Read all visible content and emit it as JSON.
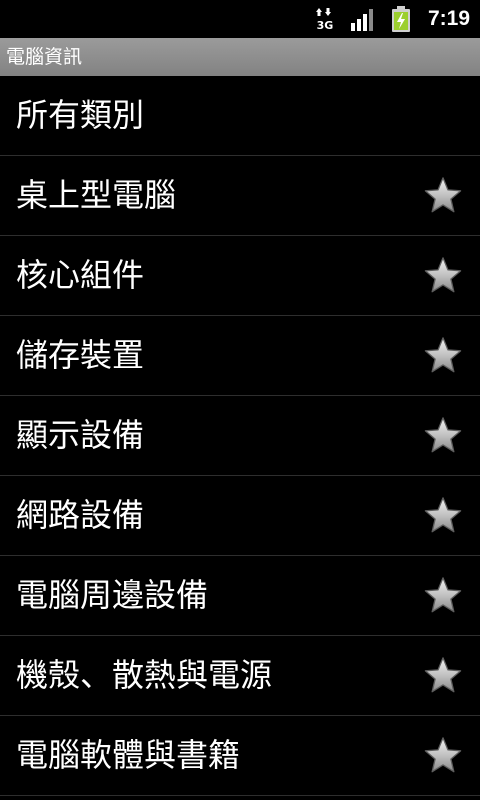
{
  "status_bar": {
    "network": "3G",
    "time": "7:19"
  },
  "title_bar": {
    "title": "電腦資訊"
  },
  "list": {
    "items": [
      {
        "label": "所有類別",
        "star": false
      },
      {
        "label": "桌上型電腦",
        "star": true
      },
      {
        "label": "核心組件",
        "star": true
      },
      {
        "label": "儲存裝置",
        "star": true
      },
      {
        "label": "顯示設備",
        "star": true
      },
      {
        "label": "網路設備",
        "star": true
      },
      {
        "label": "電腦周邊設備",
        "star": true
      },
      {
        "label": "機殼、散熱與電源",
        "star": true
      },
      {
        "label": "電腦軟體與書籍",
        "star": true
      }
    ]
  },
  "icons": {
    "star": "star-icon",
    "battery": "battery-charging-icon",
    "signal": "signal-icon",
    "data": "3g-data-icon"
  },
  "colors": {
    "background": "#000000",
    "title_bar": "#8f8f8f",
    "divider": "#2e2e2e",
    "battery": "#9ccf2f"
  }
}
